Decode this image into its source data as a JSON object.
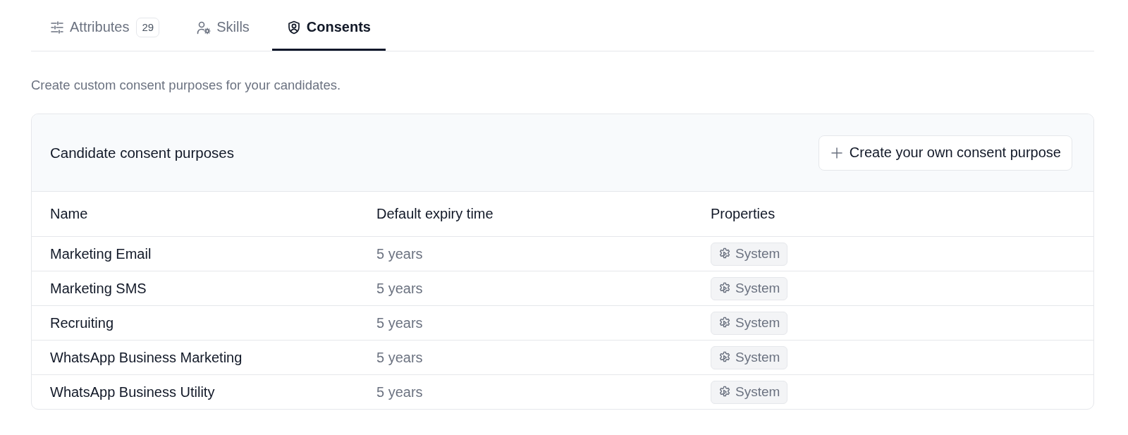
{
  "tabs": [
    {
      "label": "Attributes",
      "count": "29",
      "selected": false
    },
    {
      "label": "Skills",
      "selected": false
    },
    {
      "label": "Consents",
      "selected": true
    }
  ],
  "description": "Create custom consent purposes for your candidates.",
  "card": {
    "title": "Candidate consent purposes",
    "create_button": "Create your own consent purpose"
  },
  "table": {
    "columns": [
      "Name",
      "Default expiry time",
      "Properties"
    ],
    "rows": [
      {
        "name": "Marketing Email",
        "expiry": "5 years",
        "property": "System"
      },
      {
        "name": "Marketing SMS",
        "expiry": "5 years",
        "property": "System"
      },
      {
        "name": "Recruiting",
        "expiry": "5 years",
        "property": "System"
      },
      {
        "name": "WhatsApp Business Marketing",
        "expiry": "5 years",
        "property": "System"
      },
      {
        "name": "WhatsApp Business Utility",
        "expiry": "5 years",
        "property": "System"
      }
    ]
  }
}
